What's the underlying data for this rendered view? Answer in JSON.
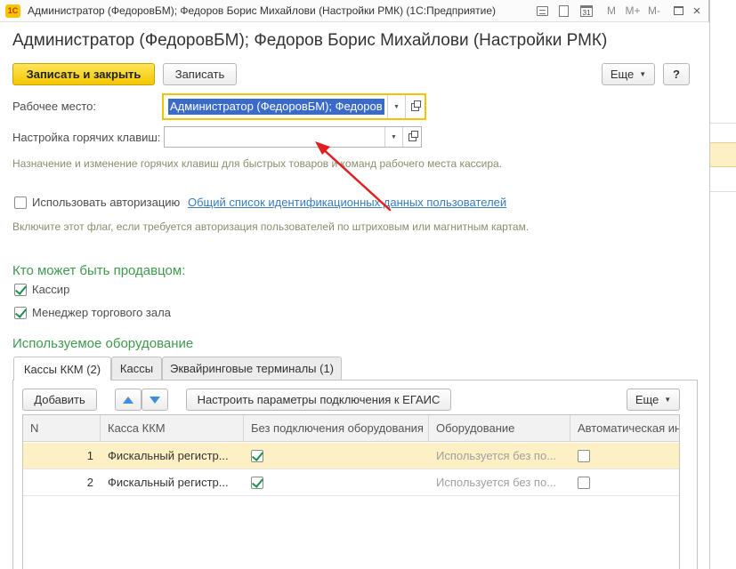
{
  "window": {
    "logo": "1С",
    "title": "Администратор (ФедоровБМ); Федоров Борис Михайлови (Настройки РМК)  (1С:Предприятие)",
    "icons": [
      "print-icon",
      "document-icon",
      "calendar-icon"
    ],
    "calendar_day": "31",
    "memory_buttons": {
      "m": "M",
      "m_plus": "M+",
      "m_minus": "M-"
    },
    "close_glyph": "×"
  },
  "form": {
    "title": "Администратор (ФедоровБМ); Федоров Борис Михайлови (Настройки РМК)",
    "buttons": {
      "save_close": "Записать и закрыть",
      "save": "Записать",
      "more": "Еще",
      "help": "?"
    },
    "workplace": {
      "label": "Рабочее место:",
      "value": "Администратор (ФедоровБМ); Федоров"
    },
    "hotkeys": {
      "label": "Настройка горячих клавиш:",
      "value": ""
    },
    "hotkeys_hint": "Назначение и изменение горячих клавиш для быстрых товаров и команд рабочего места кассира.",
    "authorization": {
      "label": "Использовать авторизацию",
      "checked": false,
      "link": "Общий список идентификационных данных пользователей",
      "hint": "Включите этот флаг, если требуется авторизация пользователей по штриховым или магнитным картам."
    },
    "sellers": {
      "title": "Кто может быть продавцом:",
      "cashier": {
        "label": "Кассир",
        "checked": true
      },
      "manager": {
        "label": "Менеджер торгового зала",
        "checked": true
      }
    },
    "equipment": {
      "title": "Используемое оборудование",
      "tabs": [
        "Кассы ККМ (2)",
        "Кассы",
        "Эквайринговые терминалы (1)"
      ],
      "active_tab": 0,
      "toolbar": {
        "add": "Добавить",
        "egais": "Настроить параметры подключения к ЕГАИС",
        "more": "Еще"
      },
      "table": {
        "columns": [
          "N",
          "Касса ККМ",
          "Без подключения оборудования",
          "Оборудование",
          "Автоматическая ин"
        ],
        "rows": [
          {
            "n": "1",
            "kkm": "Фискальный регистр...",
            "no_connection": true,
            "equipment": "Используется без по...",
            "auto": false,
            "selected": true
          },
          {
            "n": "2",
            "kkm": "Фискальный регистр...",
            "no_connection": true,
            "equipment": "Используется без по...",
            "auto": false,
            "selected": false
          }
        ]
      }
    }
  },
  "colors": {
    "primary_button": "#f2c600",
    "section_title": "#3f9a4c",
    "link": "#3a7bbd",
    "selection": "#3b6bc8",
    "row_highlight": "#fdf0c4",
    "annotation_arrow": "#e02020"
  }
}
